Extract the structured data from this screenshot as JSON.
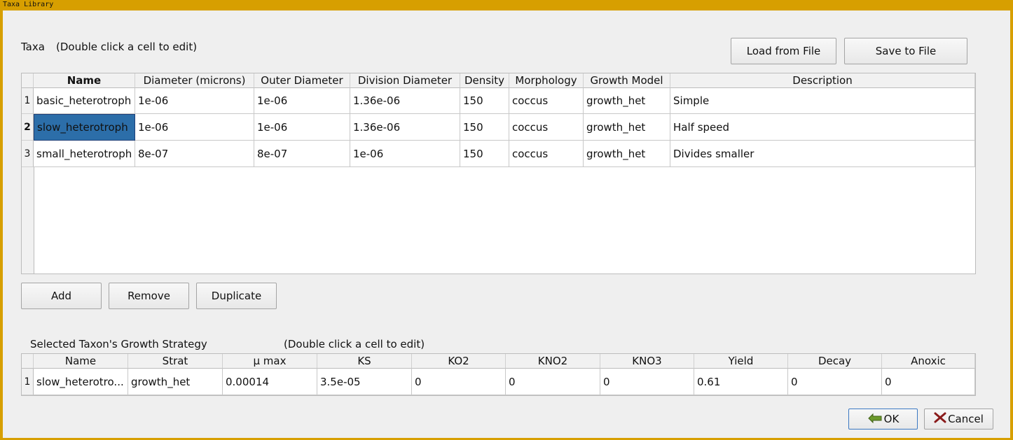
{
  "window": {
    "title": "Taxa Library"
  },
  "taxa": {
    "label": "Taxa",
    "hint": "(Double click a cell to edit)",
    "load_label": "Load from File",
    "save_label": "Save to File",
    "columns": [
      "Name",
      "Diameter (microns)",
      "Outer Diameter",
      "Division Diameter",
      "Density",
      "Morphology",
      "Growth Model",
      "Description"
    ],
    "rows": [
      {
        "num": "1",
        "cells": [
          "basic_heterotroph",
          "1e-06",
          "1e-06",
          "1.36e-06",
          "150",
          "coccus",
          "growth_het",
          "Simple"
        ]
      },
      {
        "num": "2",
        "cells": [
          "slow_heterotroph",
          "1e-06",
          "1e-06",
          "1.36e-06",
          "150",
          "coccus",
          "growth_het",
          "Half speed"
        ]
      },
      {
        "num": "3",
        "cells": [
          "small_heterotroph",
          "8e-07",
          "8e-07",
          "1e-06",
          "150",
          "coccus",
          "growth_het",
          "Divides smaller"
        ]
      }
    ],
    "add_label": "Add",
    "remove_label": "Remove",
    "duplicate_label": "Duplicate"
  },
  "growth": {
    "label": "Selected Taxon's Growth Strategy",
    "hint": "(Double click a cell to edit)",
    "columns": [
      "Name",
      "Strat",
      "µ max",
      "KS",
      "KO2",
      "KNO2",
      "KNO3",
      "Yield",
      "Decay",
      "Anoxic"
    ],
    "rows": [
      {
        "num": "1",
        "cells": [
          "slow_heterotro...",
          "growth_het",
          "0.00014",
          "3.5e-05",
          "0",
          "0",
          "0",
          "0.61",
          "0",
          "0"
        ]
      }
    ]
  },
  "dialog": {
    "ok_label": "OK",
    "cancel_label": "Cancel"
  },
  "colors": {
    "titlebar": "#d79f00",
    "selection": "#2c6ea9"
  }
}
